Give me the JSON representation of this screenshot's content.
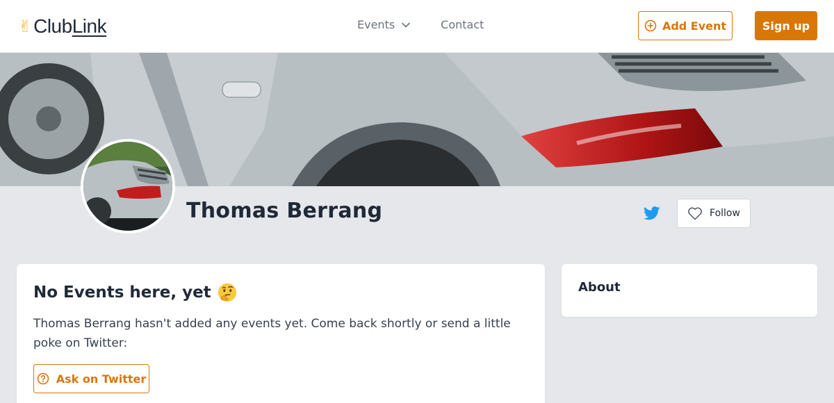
{
  "header": {
    "logo_text_plain": "Club",
    "logo_text_underlined": "Link",
    "nav": {
      "events_label": "Events",
      "contact_label": "Contact"
    },
    "add_event_label": "Add Event",
    "sign_up_label": "Sign up"
  },
  "profile": {
    "name": "Thomas Berrang",
    "follow_label": "Follow"
  },
  "events_card": {
    "title": "No Events here, yet",
    "message": "Thomas Berrang hasn't added any events yet. Come back shortly or send a little poke on Twitter:",
    "ask_button_label": "Ask on Twitter"
  },
  "about_card": {
    "title": "About"
  },
  "colors": {
    "accent": "#d97706",
    "twitter": "#1d9bf0",
    "page_background": "#e5e7eb"
  },
  "icons": {
    "logo": "victory-hand-icon",
    "events_menu": "chevron-down-icon",
    "add_event": "plus-circle-icon",
    "twitter": "twitter-icon",
    "follow": "heart-icon",
    "title_emoji": "thinking-face-icon",
    "ask": "question-circle-icon"
  }
}
